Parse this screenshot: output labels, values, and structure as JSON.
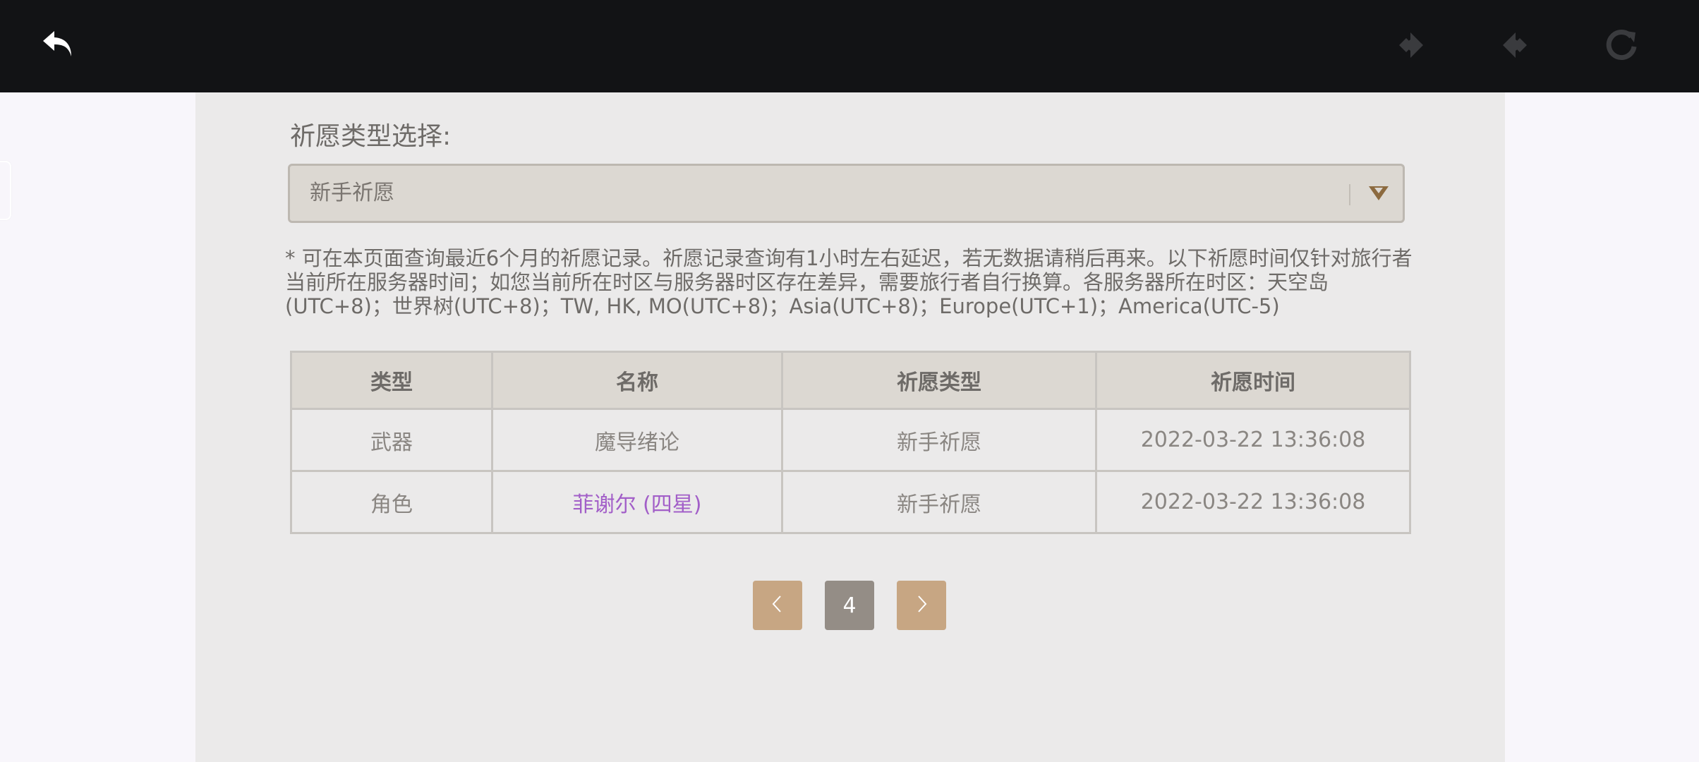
{
  "topbar": {
    "icons": {
      "back": "back-arrow-icon",
      "prev": "prev-diamond-icon",
      "next": "next-diamond-icon",
      "reload": "reload-icon"
    }
  },
  "select": {
    "label": "祈愿类型选择:",
    "value": "新手祈愿",
    "arrow_icon": "chevron-down-icon"
  },
  "notice": "* 可在本页面查询最近6个月的祈愿记录。祈愿记录查询有1小时左右延迟，若无数据请稍后再来。以下祈愿时间仅针对旅行者当前所在服务器时间；如您当前所在时区与服务器时区存在差异，需要旅行者自行换算。各服务器所在时区：天空岛(UTC+8)；世界树(UTC+8)；TW, HK, MO(UTC+8)；Asia(UTC+8)；Europe(UTC+1)；America(UTC-5)",
  "table": {
    "headers": [
      "类型",
      "名称",
      "祈愿类型",
      "祈愿时间"
    ],
    "rows": [
      [
        "武器",
        "魔导绪论",
        "新手祈愿",
        "2022-03-22 13:36:08"
      ],
      [
        "角色",
        "菲谢尔 (四星)",
        "新手祈愿",
        "2022-03-22 13:36:08"
      ]
    ]
  },
  "pager": {
    "current_page": "4",
    "prev_icon": "chevron-left-icon",
    "next_icon": "chevron-right-icon"
  },
  "colors": {
    "topbar": "#121315",
    "content_bg": "#ebeaea",
    "accent": "#c7a683",
    "four_star": "#a25ec8"
  }
}
